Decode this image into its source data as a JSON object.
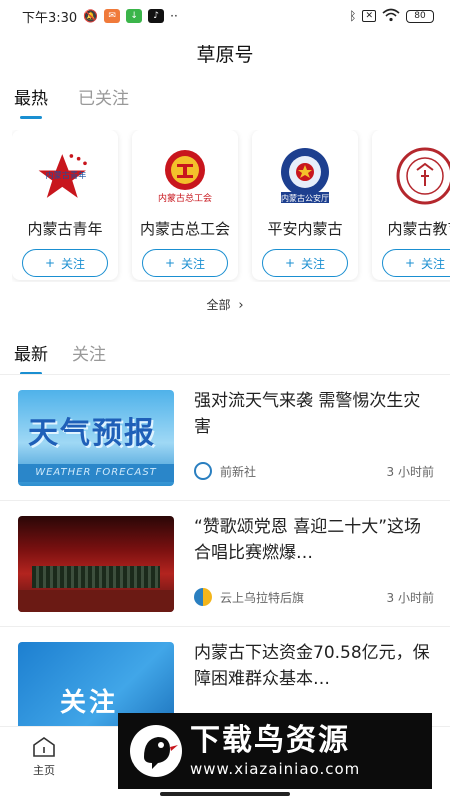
{
  "status_bar": {
    "time": "下午3:30",
    "battery": "80"
  },
  "header": {
    "title": "草原号"
  },
  "top_tabs": [
    {
      "label": "最热"
    },
    {
      "label": "已关注"
    }
  ],
  "accounts": [
    {
      "name": "内蒙古青年",
      "follow": "关注",
      "logo_text": "内蒙古青年"
    },
    {
      "name": "内蒙古总工会",
      "follow": "关注",
      "logo_text": "内蒙古总工会"
    },
    {
      "name": "平安内蒙古",
      "follow": "关注",
      "logo_text": "内蒙古公安厅"
    },
    {
      "name": "内蒙古教育",
      "follow": "关注"
    }
  ],
  "all_link": {
    "label": "全部"
  },
  "feed_tabs": [
    {
      "label": "最新"
    },
    {
      "label": "关注"
    }
  ],
  "news": [
    {
      "title": "强对流天气来袭 需警惕次生灾害",
      "source": "前新社",
      "time": "3 小时前",
      "thumb_text": "天气预报",
      "thumb_sub": "WEATHER FORECAST"
    },
    {
      "title": "“赞歌颂党恩 喜迎二十大”这场合唱比赛燃爆…",
      "source": "云上乌拉特后旗",
      "time": "3 小时前"
    },
    {
      "title": "内蒙古下达资金70.58亿元，保障困难群众基本…",
      "source": "",
      "time": "",
      "thumb_text": "关注"
    }
  ],
  "bottom_nav": {
    "home_label": "主页"
  },
  "watermark": {
    "main": "下载鸟资源",
    "url": "www.xiazainiao.com"
  },
  "colors": {
    "accent": "#1a8fd1",
    "card_red": "#c8161d"
  }
}
